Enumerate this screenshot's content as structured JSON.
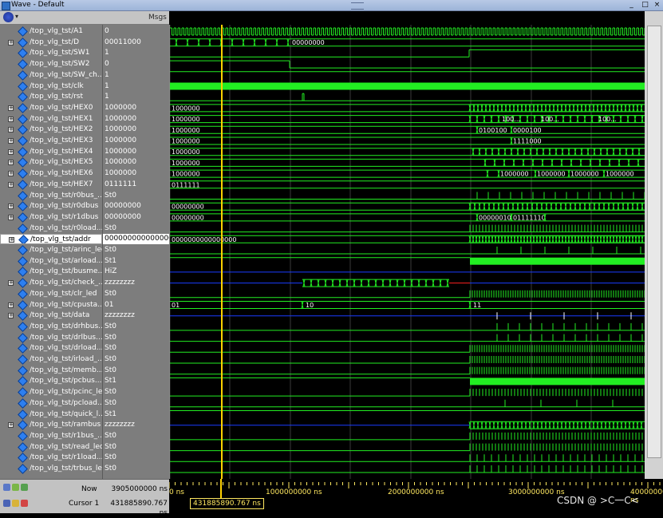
{
  "window": {
    "title": "Wave - Default"
  },
  "toolbar": {
    "msgs_label": "Msgs"
  },
  "signals": [
    {
      "name": "/top_vlg_tst/A1",
      "value": "0",
      "expand": false
    },
    {
      "name": "/top_vlg_tst/D",
      "value": "00011000",
      "expand": true
    },
    {
      "name": "/top_vlg_tst/SW1",
      "value": "1",
      "expand": false
    },
    {
      "name": "/top_vlg_tst/SW2",
      "value": "0",
      "expand": false
    },
    {
      "name": "/top_vlg_tst/SW_ch...",
      "value": "1",
      "expand": false
    },
    {
      "name": "/top_vlg_tst/clk",
      "value": "1",
      "expand": false
    },
    {
      "name": "/top_vlg_tst/rst",
      "value": "1",
      "expand": false
    },
    {
      "name": "/top_vlg_tst/HEX0",
      "value": "1000000",
      "expand": true
    },
    {
      "name": "/top_vlg_tst/HEX1",
      "value": "1000000",
      "expand": true
    },
    {
      "name": "/top_vlg_tst/HEX2",
      "value": "1000000",
      "expand": true
    },
    {
      "name": "/top_vlg_tst/HEX3",
      "value": "1000000",
      "expand": true
    },
    {
      "name": "/top_vlg_tst/HEX4",
      "value": "1000000",
      "expand": true
    },
    {
      "name": "/top_vlg_tst/HEX5",
      "value": "1000000",
      "expand": true
    },
    {
      "name": "/top_vlg_tst/HEX6",
      "value": "1000000",
      "expand": true
    },
    {
      "name": "/top_vlg_tst/HEX7",
      "value": "0111111",
      "expand": true
    },
    {
      "name": "/top_vlg_tst/r0bus_...",
      "value": "St0",
      "expand": false
    },
    {
      "name": "/top_vlg_tst/r0dbus",
      "value": "00000000",
      "expand": true
    },
    {
      "name": "/top_vlg_tst/r1dbus",
      "value": "00000000",
      "expand": true
    },
    {
      "name": "/top_vlg_tst/r0load...",
      "value": "St0",
      "expand": false
    },
    {
      "name": "/top_vlg_tst/addr",
      "value": "0000000000000000",
      "expand": true,
      "selected": true
    },
    {
      "name": "/top_vlg_tst/arinc_led",
      "value": "St0",
      "expand": false
    },
    {
      "name": "/top_vlg_tst/arload...",
      "value": "St1",
      "expand": false
    },
    {
      "name": "/top_vlg_tst/busme...",
      "value": "HiZ",
      "expand": false
    },
    {
      "name": "/top_vlg_tst/check_...",
      "value": "zzzzzzzz",
      "expand": true
    },
    {
      "name": "/top_vlg_tst/clr_led",
      "value": "St0",
      "expand": false
    },
    {
      "name": "/top_vlg_tst/cpusta...",
      "value": "01",
      "expand": true
    },
    {
      "name": "/top_vlg_tst/data",
      "value": "zzzzzzzz",
      "expand": true
    },
    {
      "name": "/top_vlg_tst/drhbus...",
      "value": "St0",
      "expand": false
    },
    {
      "name": "/top_vlg_tst/drlbus...",
      "value": "St0",
      "expand": false
    },
    {
      "name": "/top_vlg_tst/drload...",
      "value": "St0",
      "expand": false
    },
    {
      "name": "/top_vlg_tst/irload_...",
      "value": "St0",
      "expand": false
    },
    {
      "name": "/top_vlg_tst/memb...",
      "value": "St0",
      "expand": false
    },
    {
      "name": "/top_vlg_tst/pcbus...",
      "value": "St1",
      "expand": false
    },
    {
      "name": "/top_vlg_tst/pcinc_led",
      "value": "St0",
      "expand": false
    },
    {
      "name": "/top_vlg_tst/pcload...",
      "value": "St0",
      "expand": false
    },
    {
      "name": "/top_vlg_tst/quick_l...",
      "value": "St1",
      "expand": false
    },
    {
      "name": "/top_vlg_tst/rambus",
      "value": "zzzzzzzz",
      "expand": true
    },
    {
      "name": "/top_vlg_tst/r1bus_...",
      "value": "St0",
      "expand": false
    },
    {
      "name": "/top_vlg_tst/read_led",
      "value": "St0",
      "expand": false
    },
    {
      "name": "/top_vlg_tst/r1load...",
      "value": "St0",
      "expand": false
    },
    {
      "name": "/top_vlg_tst/trbus_led",
      "value": "St0",
      "expand": false
    }
  ],
  "wave_labels": {
    "D": "00000000",
    "HEX0": "1000000",
    "HEX1": "1000000",
    "HEX2": "1000000",
    "HEX3": "1000000",
    "HEX4": "1000000",
    "HEX5": "1000000",
    "HEX6": "1000000",
    "HEX7": "0111111",
    "r0dbus": "00000000",
    "r1dbus": "00000000",
    "addr": "0000000000000000",
    "cpusta_a": "01",
    "cpusta_b": "10",
    "cpusta_c": "11",
    "HEX1_late": "100...",
    "HEX1_late2": "100...",
    "HEX1_late3": "100...",
    "HEX2_late": "0100100",
    "HEX2_late2": "0000100",
    "HEX3_late": "1111000",
    "HEX6_late": "1000000",
    "HEX6_late2": "1000000",
    "HEX6_late3": "1000000",
    "HEX6_late4": "1000000",
    "r1dbus_late": "00000010",
    "r1dbus_late2": "01111110"
  },
  "status": {
    "now_label": "Now",
    "now_value": "3905000000 ns",
    "cursor_label": "Cursor 1",
    "cursor_value": "431885890.767 ns",
    "cursor_tag": "431885890.767 ns"
  },
  "timeline": {
    "ticks": [
      "0 ns",
      "1000000000 ns",
      "2000000000 ns",
      "3000000000 ns",
      "4000000000 ns"
    ]
  },
  "watermark": "CSDN @ >C一C<",
  "colors": {
    "wave": "#22ee22",
    "cursor": "#ffd200",
    "bus_z": "#1a3cff",
    "bg": "#000000"
  }
}
